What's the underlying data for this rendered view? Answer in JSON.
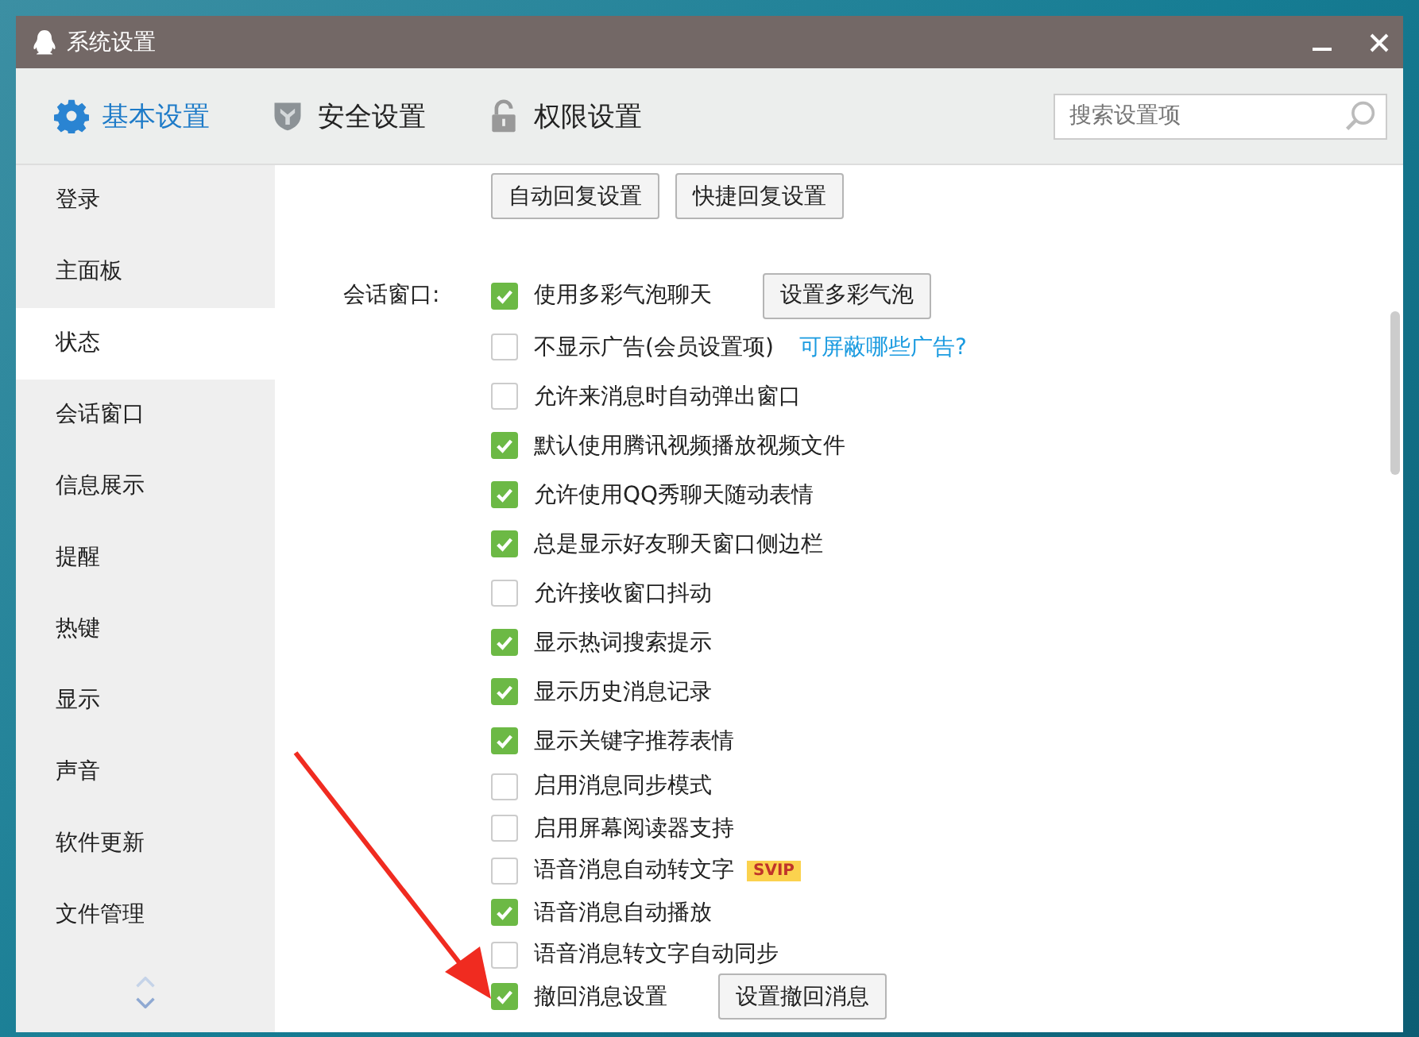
{
  "window": {
    "title": "系统设置"
  },
  "tabs": [
    {
      "label": "基本设置",
      "selected": true
    },
    {
      "label": "安全设置",
      "selected": false
    },
    {
      "label": "权限设置",
      "selected": false
    }
  ],
  "search": {
    "placeholder": "搜索设置项"
  },
  "sidebar": {
    "items": [
      {
        "label": "登录",
        "selected": false
      },
      {
        "label": "主面板",
        "selected": false
      },
      {
        "label": "状态",
        "selected": true
      },
      {
        "label": "会话窗口",
        "selected": false
      },
      {
        "label": "信息展示",
        "selected": false
      },
      {
        "label": "提醒",
        "selected": false
      },
      {
        "label": "热键",
        "selected": false
      },
      {
        "label": "显示",
        "selected": false
      },
      {
        "label": "声音",
        "selected": false
      },
      {
        "label": "软件更新",
        "selected": false
      },
      {
        "label": "文件管理",
        "selected": false
      }
    ]
  },
  "top_buttons": [
    "自动回复设置",
    "快捷回复设置"
  ],
  "section": {
    "label": "会话窗口:",
    "options": [
      {
        "label": "使用多彩气泡聊天",
        "checked": true,
        "button": "设置多彩气泡"
      },
      {
        "label": "不显示广告(会员设置项)",
        "checked": false,
        "link": "可屏蔽哪些广告?"
      },
      {
        "label": "允许来消息时自动弹出窗口",
        "checked": false
      },
      {
        "label": "默认使用腾讯视频播放视频文件",
        "checked": true
      },
      {
        "label": "允许使用QQ秀聊天随动表情",
        "checked": true
      },
      {
        "label": "总是显示好友聊天窗口侧边栏",
        "checked": true
      },
      {
        "label": "允许接收窗口抖动",
        "checked": false
      },
      {
        "label": "显示热词搜索提示",
        "checked": true
      },
      {
        "label": "显示历史消息记录",
        "checked": true
      },
      {
        "label": "显示关键字推荐表情",
        "checked": true
      },
      {
        "label": "启用消息同步模式",
        "checked": false
      },
      {
        "label": "启用屏幕阅读器支持",
        "checked": false
      },
      {
        "label": "语音消息自动转文字",
        "checked": false,
        "badge": "SVIP"
      },
      {
        "label": "语音消息自动播放",
        "checked": true
      },
      {
        "label": "语音消息转文字自动同步",
        "checked": false
      },
      {
        "label": "撤回消息设置",
        "checked": true,
        "button": "设置撤回消息"
      }
    ]
  }
}
